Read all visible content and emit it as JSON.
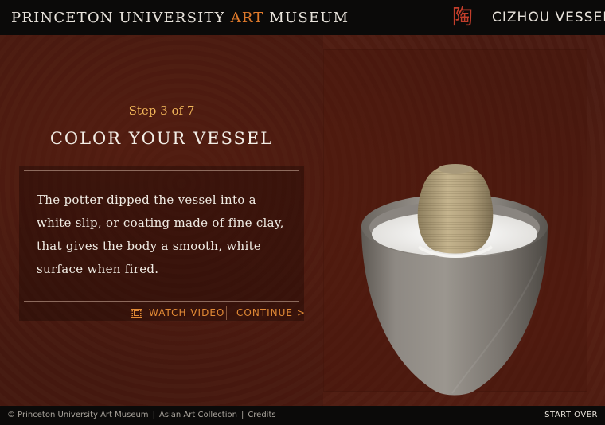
{
  "header": {
    "brand_prefix": "PRINCETON UNIVERSITY",
    "brand_accent": "ART",
    "brand_suffix": "MUSEUM",
    "logo_glyph": "陶",
    "app_title": "CIZHOU VESSEL"
  },
  "main": {
    "step_label": "Step 3 of 7",
    "title": "COLOR YOUR VESSEL",
    "body": "The potter dipped the vessel into a white slip, or coating made of fine clay, that gives the body a smooth, white surface when fired.",
    "watch_video_label": "WATCH VIDEO",
    "continue_label": "CONTINUE >",
    "watch_video_icon": "film-icon"
  },
  "footer": {
    "copyright": "© Princeton University Art Museum",
    "link_asian": "Asian Art Collection",
    "link_credits": "Credits",
    "separator": "|",
    "start_over_label": "START OVER"
  },
  "colors": {
    "accent": "#e28a35",
    "brand_accent": "#e07a2b",
    "step_text": "#f2b75a",
    "background": "#4a1b11",
    "logo": "#c33e2b"
  }
}
